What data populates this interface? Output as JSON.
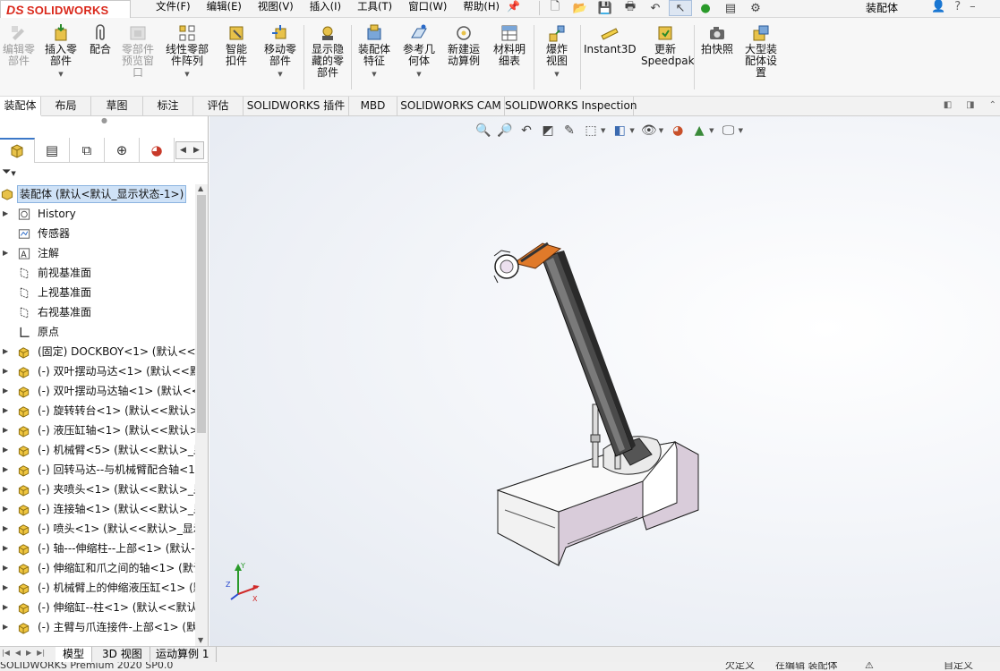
{
  "app": {
    "brand_prefix": "DS",
    "brand": "SOLIDWORKS",
    "doc_title": "装配体"
  },
  "menus": [
    "文件(F)",
    "编辑(E)",
    "视图(V)",
    "插入(I)",
    "工具(T)",
    "窗口(W)",
    "帮助(H)"
  ],
  "ribbon": {
    "edit_component": "编辑零部件",
    "insert_components": "插入零部件",
    "mate": "配合",
    "component_preview": "零部件预览窗口",
    "linear_pattern": "线性零部件阵列",
    "smart_fasteners": "智能扣件",
    "move_component": "移动零部件",
    "show_hidden": "显示隐藏的零部件",
    "assembly_features": "装配体特征",
    "reference_geometry": "参考几何体",
    "new_motion_study": "新建运动算例",
    "bom": "材料明细表",
    "exploded_view": "爆炸视图",
    "instant3d": "Instant3D",
    "update_speedpak": "更新Speedpak",
    "snapshot": "拍快照",
    "large_assembly": "大型装配体设置"
  },
  "tabs": [
    "装配体",
    "布局",
    "草图",
    "标注",
    "评估",
    "SOLIDWORKS 插件",
    "MBD",
    "SOLIDWORKS CAM",
    "SOLIDWORKS Inspection"
  ],
  "tree": {
    "root": "装配体 (默认<默认_显示状态-1>)",
    "items": [
      {
        "label": "History",
        "icon": "history-icon",
        "expandable": true
      },
      {
        "label": "传感器",
        "icon": "sensor-icon",
        "expandable": false
      },
      {
        "label": "注解",
        "icon": "annotation-icon",
        "expandable": true
      },
      {
        "label": "前视基准面",
        "icon": "plane-icon",
        "expandable": false
      },
      {
        "label": "上视基准面",
        "icon": "plane-icon",
        "expandable": false
      },
      {
        "label": "右视基准面",
        "icon": "plane-icon",
        "expandable": false
      },
      {
        "label": "原点",
        "icon": "origin-icon",
        "expandable": false
      },
      {
        "label": "(固定) DOCKBOY<1> (默认<<默",
        "icon": "component-icon",
        "expandable": true
      },
      {
        "label": "(-) 双叶摆动马达<1> (默认<<默",
        "icon": "component-icon",
        "expandable": true
      },
      {
        "label": "(-) 双叶摆动马达轴<1> (默认<<",
        "icon": "component-icon",
        "expandable": true
      },
      {
        "label": "(-) 旋转转台<1> (默认<<默认>_",
        "icon": "component-icon",
        "expandable": true
      },
      {
        "label": "(-) 液压缸轴<1> (默认<<默认>_",
        "icon": "component-icon",
        "expandable": true
      },
      {
        "label": "(-) 机械臂<5> (默认<<默认>_显",
        "icon": "component-icon",
        "expandable": true
      },
      {
        "label": "(-) 回转马达--与机械臂配合轴<1",
        "icon": "component-icon",
        "expandable": true
      },
      {
        "label": "(-) 夹喷头<1> (默认<<默认>_显",
        "icon": "component-icon",
        "expandable": true
      },
      {
        "label": "(-) 连接轴<1> (默认<<默认>_显",
        "icon": "component-icon",
        "expandable": true
      },
      {
        "label": "(-) 喷头<1> (默认<<默认>_显示",
        "icon": "component-icon",
        "expandable": true
      },
      {
        "label": "(-) 轴---伸缩柱--上部<1> (默认-",
        "icon": "component-icon",
        "expandable": true
      },
      {
        "label": "(-) 伸缩缸和爪之间的轴<1> (默认",
        "icon": "component-icon",
        "expandable": true
      },
      {
        "label": "(-) 机械臂上的伸缩液压缸<1> (默",
        "icon": "component-icon",
        "expandable": true
      },
      {
        "label": "(-) 伸缩缸--柱<1> (默认<<默认",
        "icon": "component-icon",
        "expandable": true
      },
      {
        "label": "(-) 主臂与爪连接件-上部<1> (默",
        "icon": "component-icon",
        "expandable": true
      }
    ]
  },
  "bottom_tabs": [
    "模型",
    "3D 视图",
    "运动算例 1"
  ],
  "status": {
    "left": "SOLIDWORKS Premium 2020 SP0.0",
    "mid1": "欠定义",
    "mid2": "在编辑 装配体",
    "right": "自定义"
  },
  "triad": {
    "x": "X",
    "y": "Y",
    "z": "Z"
  },
  "colors": {
    "brand_red": "#da291c",
    "selection_blue": "#cfe2f7",
    "model_base": "#d9ccda",
    "model_arm": "#4a4a4a",
    "model_accent": "#e07a2a"
  }
}
